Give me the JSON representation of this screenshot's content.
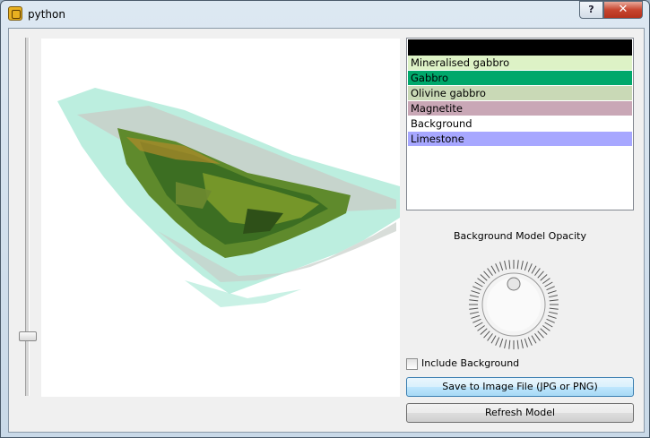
{
  "window": {
    "title": "python",
    "help_label": "?",
    "close_label": "✕"
  },
  "icons": {
    "app": "python-app-icon",
    "help": "help-icon",
    "close": "close-icon"
  },
  "slider": {
    "level_fraction": 0.17
  },
  "model_view": {
    "content": "3d-geological-model-render"
  },
  "legend": {
    "header_color": "#000000",
    "items": [
      {
        "label": "Mineralised gabbro",
        "color": "#ddf2c6"
      },
      {
        "label": "Gabbro",
        "color": "#00a86b"
      },
      {
        "label": "Olivine gabbro",
        "color": "#c9d9b6"
      },
      {
        "label": "Magnetite",
        "color": "#c9a7b6"
      },
      {
        "label": "Background",
        "color": "#ffffff"
      },
      {
        "label": "Limestone",
        "color": "#a7a7ff"
      }
    ]
  },
  "opacity": {
    "label": "Background Model Opacity"
  },
  "include_background": {
    "label": "Include Background",
    "checked": false
  },
  "buttons": {
    "save": "Save to Image File (JPG or PNG)",
    "refresh": "Refresh Model"
  }
}
